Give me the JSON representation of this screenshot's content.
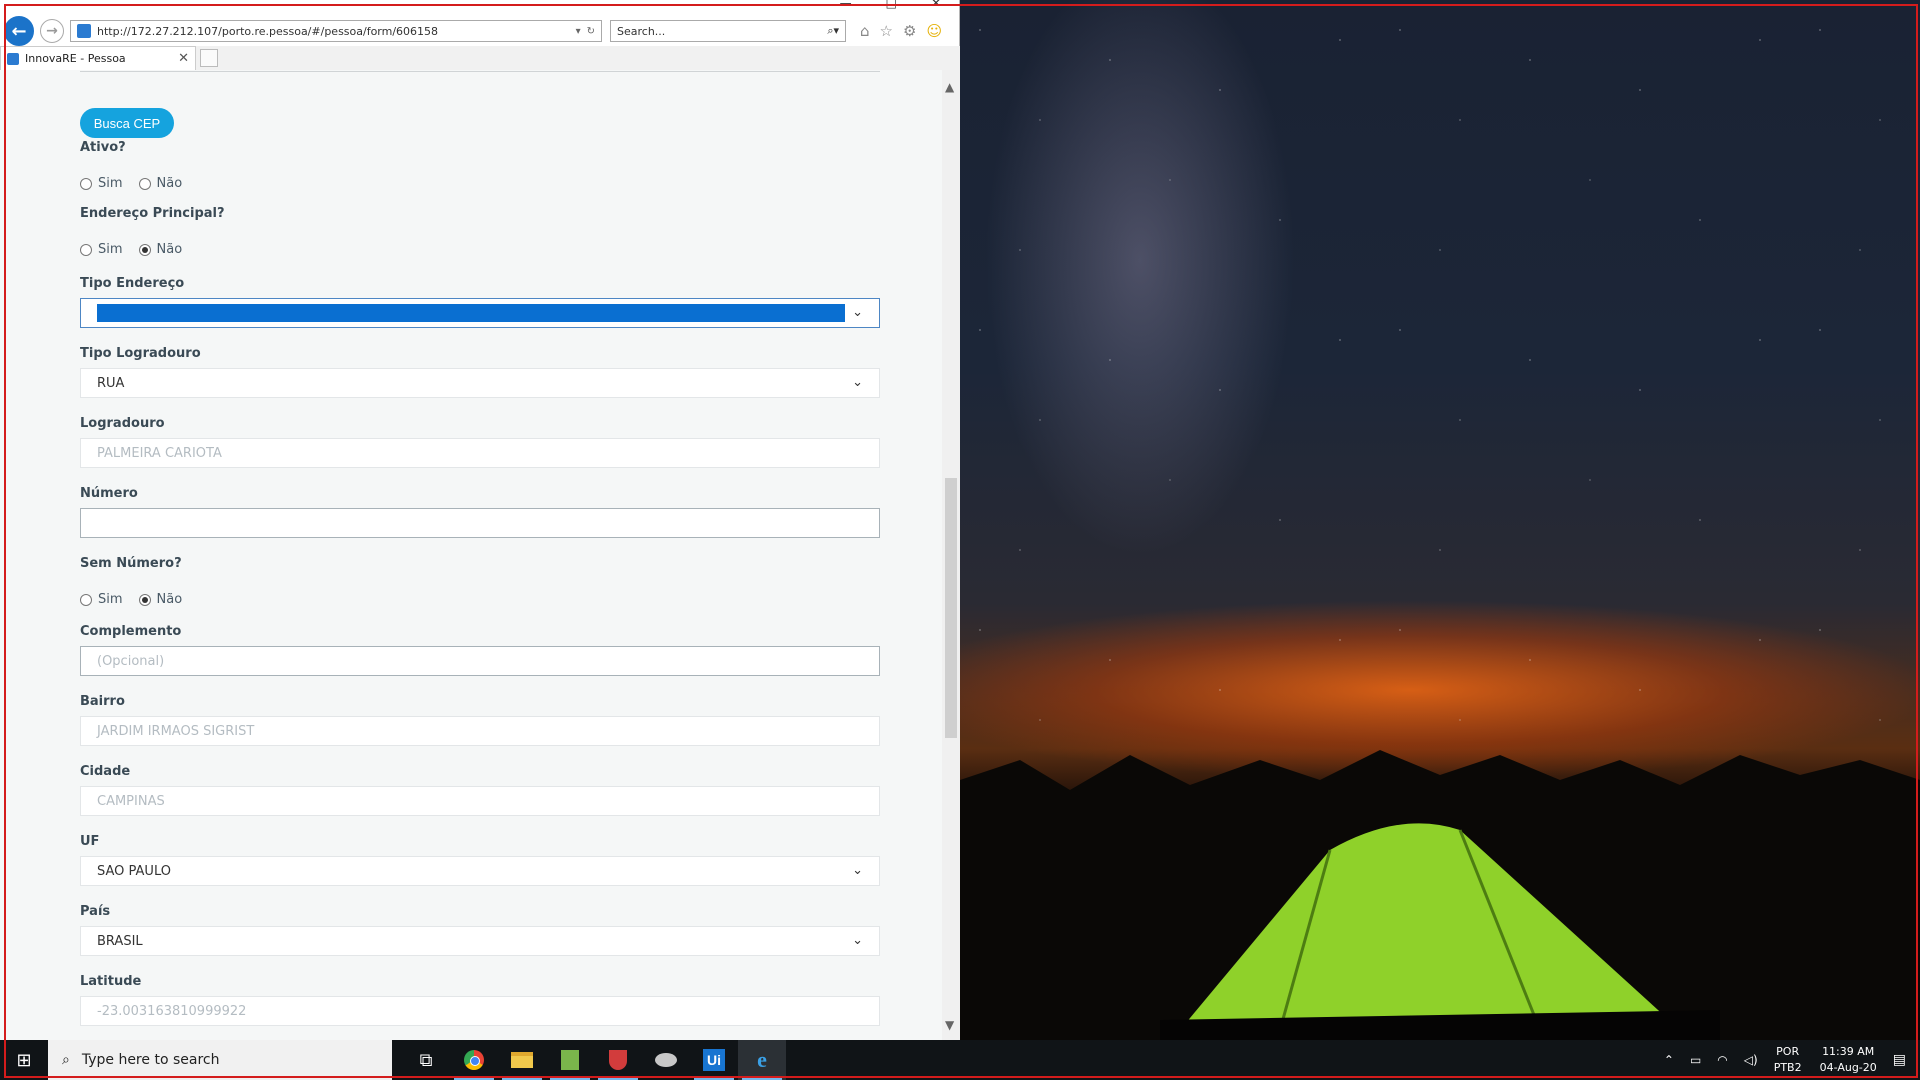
{
  "browser": {
    "url": "http://172.27.212.107/porto.re.pessoa/#/pessoa/form/606158",
    "search_placeholder": "Search...",
    "tab_title": "InnovaRE - Pessoa"
  },
  "form": {
    "busca_cep_label": "Busca CEP",
    "ativo": {
      "label": "Ativo?",
      "options": [
        "Sim",
        "Não"
      ],
      "selected": null
    },
    "endereco_principal": {
      "label": "Endereço Principal?",
      "options": [
        "Sim",
        "Não"
      ],
      "selected": "Não"
    },
    "tipo_endereco": {
      "label": "Tipo Endereço",
      "value": ""
    },
    "tipo_logradouro": {
      "label": "Tipo Logradouro",
      "value": "RUA"
    },
    "logradouro": {
      "label": "Logradouro",
      "value": "PALMEIRA CARIOTA"
    },
    "numero": {
      "label": "Número",
      "value": ""
    },
    "sem_numero": {
      "label": "Sem Número?",
      "options": [
        "Sim",
        "Não"
      ],
      "selected": "Não"
    },
    "complemento": {
      "label": "Complemento",
      "placeholder": "(Opcional)"
    },
    "bairro": {
      "label": "Bairro",
      "value": "JARDIM IRMAOS SIGRIST"
    },
    "cidade": {
      "label": "Cidade",
      "value": "CAMPINAS"
    },
    "uf": {
      "label": "UF",
      "value": "SAO PAULO"
    },
    "pais": {
      "label": "País",
      "value": "BRASIL"
    },
    "latitude": {
      "label": "Latitude",
      "value": "-23.003163810999922"
    }
  },
  "taskbar": {
    "search_placeholder": "Type here to search",
    "language": "POR",
    "keyboard": "PTB2",
    "time": "11:39 AM",
    "date": "04-Aug-20",
    "apps": [
      "task-view",
      "chrome",
      "file-explorer",
      "spreadsheet",
      "shield-app",
      "bird-app",
      "uipath",
      "internet-explorer"
    ]
  },
  "colors": {
    "accent": "#15a3de",
    "select_highlight": "#0a6fd1",
    "label": "#3a4a55",
    "frame": "#d41c1c"
  }
}
